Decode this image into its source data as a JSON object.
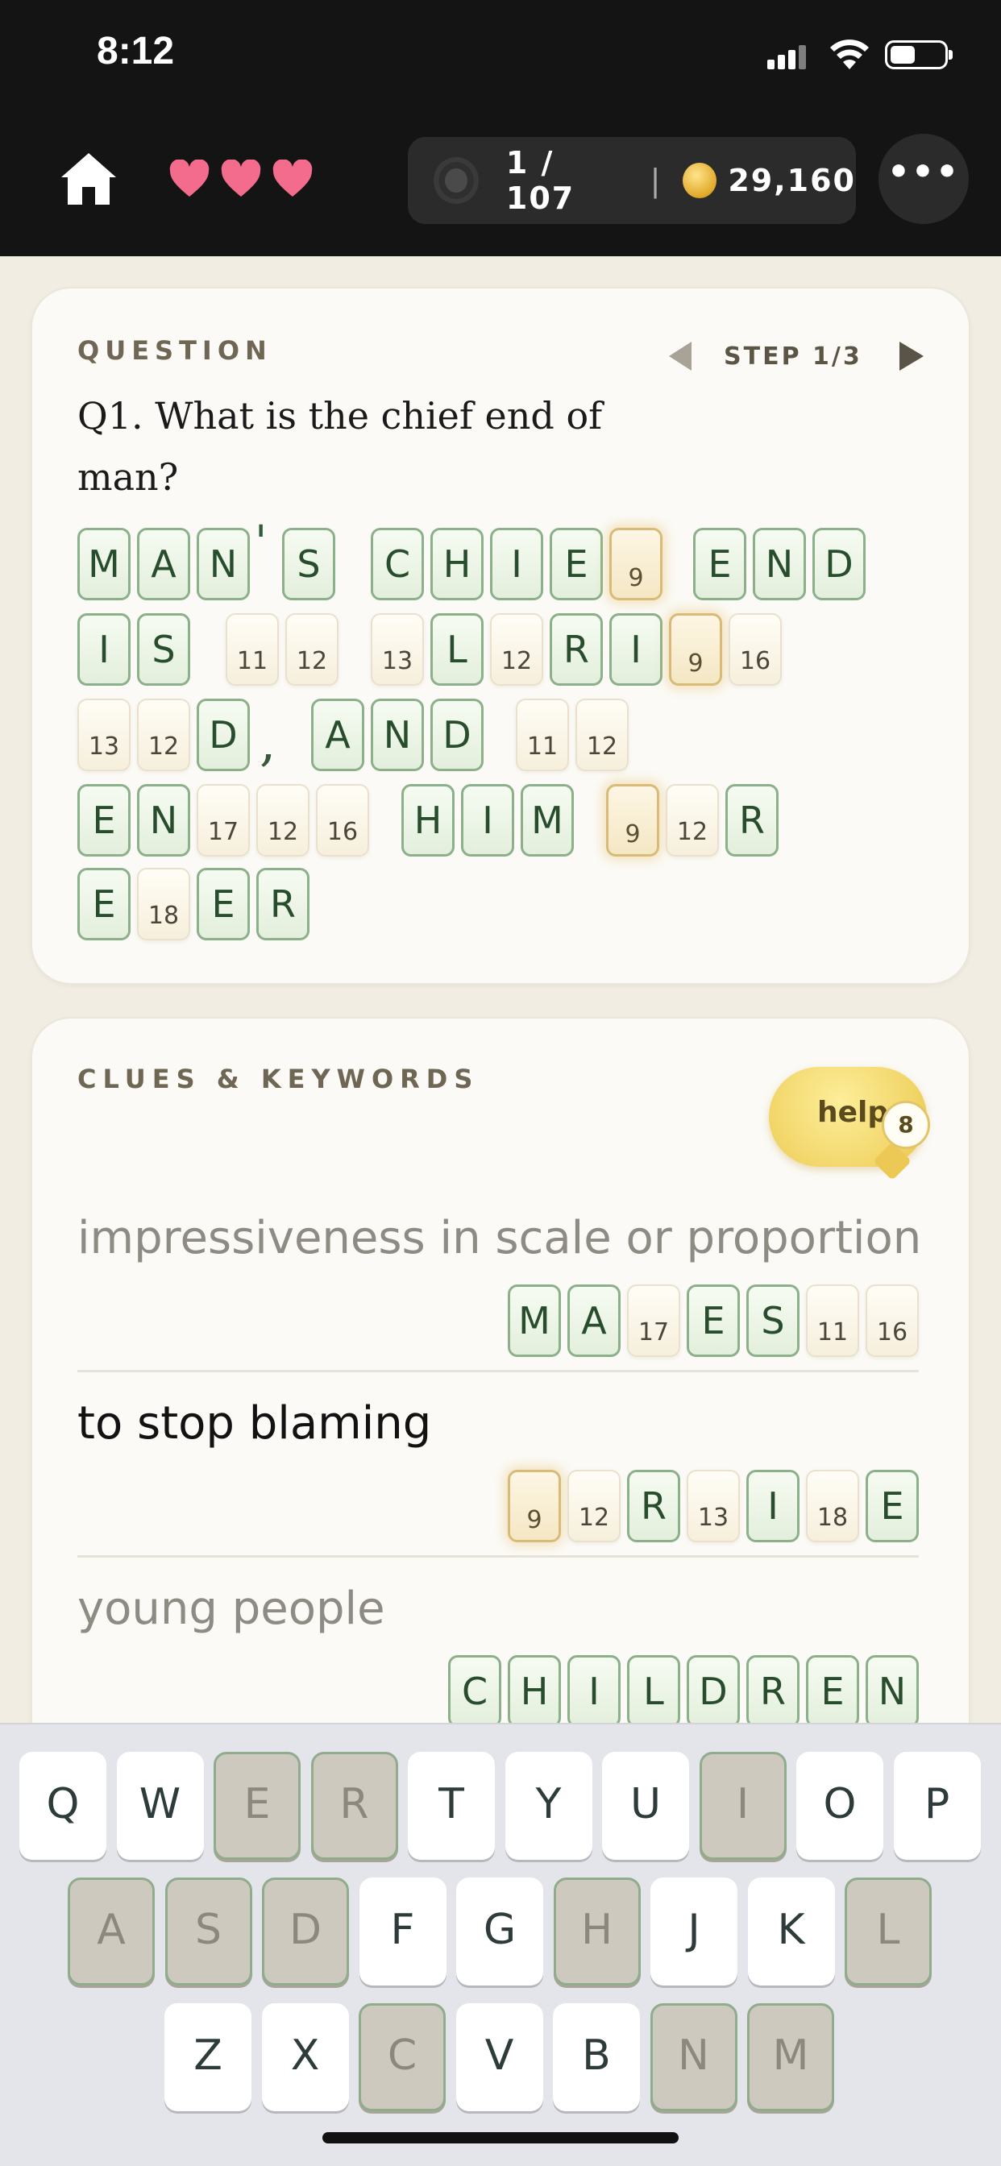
{
  "status": {
    "time": "8:12",
    "battery_level": 0.45
  },
  "header": {
    "lives": 3,
    "progress": "1 / 107",
    "separator": "|",
    "coins": "29,160",
    "more_label": "•••",
    "icons": [
      "home-icon",
      "heart-icon",
      "progress-ring-icon",
      "coin-icon",
      "more-icon"
    ]
  },
  "question": {
    "label": "QUESTION",
    "step": "STEP 1/3",
    "text": "Q1. What is the chief end of man?"
  },
  "answer_tiles": [
    {
      "t": "L",
      "v": "M"
    },
    {
      "t": "L",
      "v": "A"
    },
    {
      "t": "L",
      "v": "N"
    },
    {
      "t": "P",
      "v": "'"
    },
    {
      "t": "L",
      "v": "S"
    },
    {
      "t": "L",
      "v": "C"
    },
    {
      "t": "L",
      "v": "H"
    },
    {
      "t": "L",
      "v": "I"
    },
    {
      "t": "L",
      "v": "E"
    },
    {
      "t": "H",
      "v": "9"
    },
    {
      "t": "L",
      "v": "E"
    },
    {
      "t": "L",
      "v": "N"
    },
    {
      "t": "L",
      "v": "D"
    },
    {
      "t": "L",
      "v": "I"
    },
    {
      "t": "L",
      "v": "S"
    },
    {
      "t": "N",
      "v": "11"
    },
    {
      "t": "N",
      "v": "12"
    },
    {
      "t": "N",
      "v": "13"
    },
    {
      "t": "L",
      "v": "L"
    },
    {
      "t": "N",
      "v": "12"
    },
    {
      "t": "L",
      "v": "R"
    },
    {
      "t": "L",
      "v": "I"
    },
    {
      "t": "H",
      "v": "9"
    },
    {
      "t": "N",
      "v": "16"
    },
    {
      "t": "N",
      "v": "13"
    },
    {
      "t": "N",
      "v": "12"
    },
    {
      "t": "L",
      "v": "D"
    },
    {
      "t": "P",
      "v": ","
    },
    {
      "t": "L",
      "v": "A"
    },
    {
      "t": "L",
      "v": "N"
    },
    {
      "t": "L",
      "v": "D"
    },
    {
      "t": "N",
      "v": "11"
    },
    {
      "t": "N",
      "v": "12"
    },
    {
      "t": "L",
      "v": "E"
    },
    {
      "t": "L",
      "v": "N"
    },
    {
      "t": "N",
      "v": "17"
    },
    {
      "t": "N",
      "v": "12"
    },
    {
      "t": "N",
      "v": "16"
    },
    {
      "t": "L",
      "v": "H"
    },
    {
      "t": "L",
      "v": "I"
    },
    {
      "t": "L",
      "v": "M"
    },
    {
      "t": "H",
      "v": "9"
    },
    {
      "t": "N",
      "v": "12"
    },
    {
      "t": "L",
      "v": "R"
    },
    {
      "t": "L",
      "v": "E"
    },
    {
      "t": "N",
      "v": "18"
    },
    {
      "t": "L",
      "v": "E"
    },
    {
      "t": "L",
      "v": "R"
    }
  ],
  "clues": {
    "label": "CLUES & KEYWORDS",
    "help_label": "help",
    "help_count": "8",
    "items": [
      {
        "text": "impressiveness in scale or proportion",
        "state": "dim",
        "tiles": [
          {
            "t": "L",
            "v": "M"
          },
          {
            "t": "L",
            "v": "A"
          },
          {
            "t": "N",
            "v": "17"
          },
          {
            "t": "L",
            "v": "E"
          },
          {
            "t": "L",
            "v": "S"
          },
          {
            "t": "N",
            "v": "11"
          },
          {
            "t": "N",
            "v": "16"
          }
        ]
      },
      {
        "text": "to stop blaming",
        "state": "active",
        "tiles": [
          {
            "t": "H",
            "v": "9"
          },
          {
            "t": "N",
            "v": "12"
          },
          {
            "t": "L",
            "v": "R"
          },
          {
            "t": "N",
            "v": "13"
          },
          {
            "t": "L",
            "v": "I"
          },
          {
            "t": "N",
            "v": "18"
          },
          {
            "t": "L",
            "v": "E"
          }
        ]
      },
      {
        "text": "young people",
        "state": "dim",
        "tiles": [
          {
            "t": "L",
            "v": "C"
          },
          {
            "t": "L",
            "v": "H"
          },
          {
            "t": "L",
            "v": "I"
          },
          {
            "t": "L",
            "v": "L"
          },
          {
            "t": "L",
            "v": "D"
          },
          {
            "t": "L",
            "v": "R"
          },
          {
            "t": "L",
            "v": "E"
          },
          {
            "t": "L",
            "v": "N"
          }
        ]
      }
    ]
  },
  "keyboard": {
    "rows": [
      [
        {
          "k": "Q"
        },
        {
          "k": "W"
        },
        {
          "k": "E",
          "used": true
        },
        {
          "k": "R",
          "used": true
        },
        {
          "k": "T"
        },
        {
          "k": "Y"
        },
        {
          "k": "U"
        },
        {
          "k": "I",
          "used": true
        },
        {
          "k": "O"
        },
        {
          "k": "P"
        }
      ],
      [
        {
          "k": "A",
          "used": true
        },
        {
          "k": "S",
          "used": true
        },
        {
          "k": "D",
          "used": true
        },
        {
          "k": "F"
        },
        {
          "k": "G"
        },
        {
          "k": "H",
          "used": true
        },
        {
          "k": "J"
        },
        {
          "k": "K"
        },
        {
          "k": "L",
          "used": true
        }
      ],
      [
        {
          "k": "Z"
        },
        {
          "k": "X"
        },
        {
          "k": "C",
          "used": true
        },
        {
          "k": "V"
        },
        {
          "k": "B"
        },
        {
          "k": "N",
          "used": true
        },
        {
          "k": "M",
          "used": true
        }
      ]
    ]
  }
}
